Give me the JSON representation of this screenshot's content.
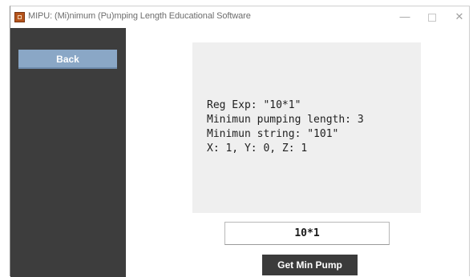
{
  "window": {
    "title": "MIPU: (Mi)nimum (Pu)mping Length Educational Software",
    "controls": {
      "minimize": "—",
      "close": "✕"
    }
  },
  "sidebar": {
    "back_label": "Back"
  },
  "output": {
    "lines": [
      "Reg Exp: \"10*1\"",
      "Minimun pumping length: 3",
      "Minimun string: \"101\"",
      "X: 1, Y: 0, Z: 1"
    ]
  },
  "regex_input": {
    "value": "10*1"
  },
  "actions": {
    "get_min_pump_label": "Get Min Pump"
  },
  "colors": {
    "sidebar_bg": "#3d3d3d",
    "back_button_bg": "#8aa7c6",
    "output_panel_bg": "#efefef",
    "action_button_bg": "#3b3b3b",
    "app_icon": "#b5541c"
  },
  "icons": {
    "app": "app-logo-icon",
    "minimize": "minimize-icon",
    "maximize": "maximize-icon",
    "close": "close-icon"
  }
}
